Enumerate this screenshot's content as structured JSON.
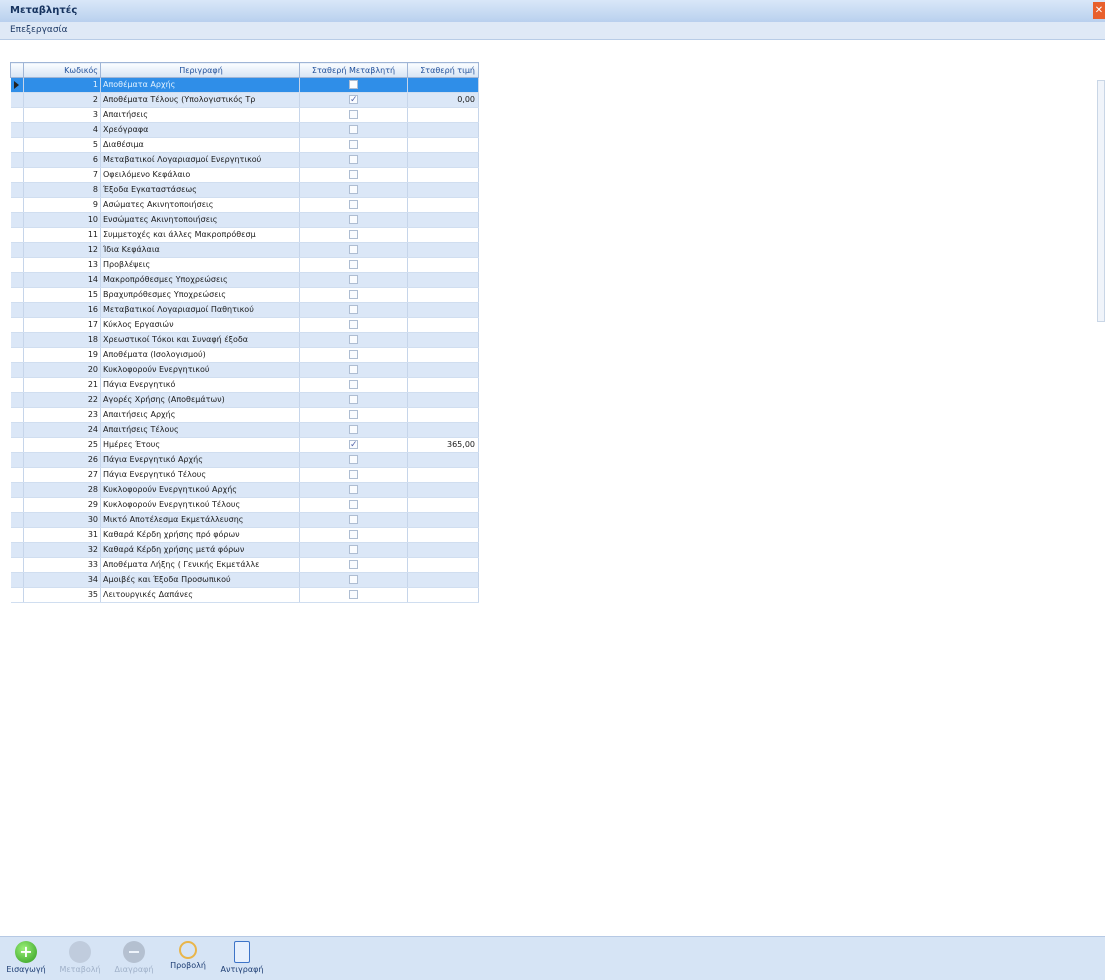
{
  "window": {
    "title": "Μεταβλητές"
  },
  "menu": {
    "tools": "Επεξεργασία"
  },
  "grid": {
    "headers": {
      "code": "Κωδικός",
      "description": "Περιγραφή",
      "fixed_variable": "Σταθερή Μεταβλητή",
      "fixed_value": "Σταθερή τιμή"
    },
    "rows": [
      {
        "code": "1",
        "description": "Αποθέματα Αρχής",
        "fixed": false,
        "value": ""
      },
      {
        "code": "2",
        "description": "Αποθέματα Τέλους (Υπολογιστικός Τρ",
        "fixed": true,
        "value": "0,00"
      },
      {
        "code": "3",
        "description": "Απαιτήσεις",
        "fixed": false,
        "value": ""
      },
      {
        "code": "4",
        "description": "Χρεόγραφα",
        "fixed": false,
        "value": ""
      },
      {
        "code": "5",
        "description": "Διαθέσιμα",
        "fixed": false,
        "value": ""
      },
      {
        "code": "6",
        "description": "Μεταβατικοί Λογαριασμοί Ενεργητικού",
        "fixed": false,
        "value": ""
      },
      {
        "code": "7",
        "description": "Οφειλόμενο Κεφάλαιο",
        "fixed": false,
        "value": ""
      },
      {
        "code": "8",
        "description": "Έξοδα Εγκαταστάσεως",
        "fixed": false,
        "value": ""
      },
      {
        "code": "9",
        "description": "Ασώματες Ακινητοποιήσεις",
        "fixed": false,
        "value": ""
      },
      {
        "code": "10",
        "description": "Ενσώματες Ακινητοποιήσεις",
        "fixed": false,
        "value": ""
      },
      {
        "code": "11",
        "description": "Συμμετοχές και άλλες Μακροπρόθεσμ",
        "fixed": false,
        "value": ""
      },
      {
        "code": "12",
        "description": "Ίδια Κεφάλαια",
        "fixed": false,
        "value": ""
      },
      {
        "code": "13",
        "description": "Προβλέψεις",
        "fixed": false,
        "value": ""
      },
      {
        "code": "14",
        "description": "Μακροπρόθεσμες Υποχρεώσεις",
        "fixed": false,
        "value": ""
      },
      {
        "code": "15",
        "description": "Βραχυπρόθεσμες Υποχρεώσεις",
        "fixed": false,
        "value": ""
      },
      {
        "code": "16",
        "description": "Μεταβατικοί Λογαριασμοί Παθητικού",
        "fixed": false,
        "value": ""
      },
      {
        "code": "17",
        "description": "Κύκλος Εργασιών",
        "fixed": false,
        "value": ""
      },
      {
        "code": "18",
        "description": "Χρεωστικοί Τόκοι και Συναφή έξοδα",
        "fixed": false,
        "value": ""
      },
      {
        "code": "19",
        "description": "Αποθέματα (Ισολογισμού)",
        "fixed": false,
        "value": ""
      },
      {
        "code": "20",
        "description": "Κυκλοφορούν Ενεργητικού",
        "fixed": false,
        "value": ""
      },
      {
        "code": "21",
        "description": "Πάγια Ενεργητικό",
        "fixed": false,
        "value": ""
      },
      {
        "code": "22",
        "description": "Αγορές Χρήσης (Αποθεμάτων)",
        "fixed": false,
        "value": ""
      },
      {
        "code": "23",
        "description": "Απαιτήσεις Αρχής",
        "fixed": false,
        "value": ""
      },
      {
        "code": "24",
        "description": "Απαιτήσεις Τέλους",
        "fixed": false,
        "value": ""
      },
      {
        "code": "25",
        "description": "Ημέρες Έτους",
        "fixed": true,
        "value": "365,00"
      },
      {
        "code": "26",
        "description": "Πάγια Ενεργητικό Αρχής",
        "fixed": false,
        "value": ""
      },
      {
        "code": "27",
        "description": "Πάγια Ενεργητικό Τέλους",
        "fixed": false,
        "value": ""
      },
      {
        "code": "28",
        "description": "Κυκλοφορούν Ενεργητικού Αρχής",
        "fixed": false,
        "value": ""
      },
      {
        "code": "29",
        "description": "Κυκλοφορούν Ενεργητικού Τέλους",
        "fixed": false,
        "value": ""
      },
      {
        "code": "30",
        "description": "Μικτό Αποτέλεσμα Εκμετάλλευσης",
        "fixed": false,
        "value": ""
      },
      {
        "code": "31",
        "description": "Καθαρά Κέρδη χρήσης πρό φόρων",
        "fixed": false,
        "value": ""
      },
      {
        "code": "32",
        "description": "Καθαρά Κέρδη χρήσης μετά φόρων",
        "fixed": false,
        "value": ""
      },
      {
        "code": "33",
        "description": "Αποθέματα Λήξης ( Γενικής Εκμετάλλε",
        "fixed": false,
        "value": ""
      },
      {
        "code": "34",
        "description": "Αμοιβές και Έξοδα Προσωπικού",
        "fixed": false,
        "value": ""
      },
      {
        "code": "35",
        "description": "Λειτουργικές Δαπάνες",
        "fixed": false,
        "value": ""
      }
    ]
  },
  "toolbar": {
    "insert": "Εισαγωγή",
    "edit": "Μεταβολή",
    "delete": "Διαγραφή",
    "view": "Προβολή",
    "copy": "Αντιγραφή"
  }
}
